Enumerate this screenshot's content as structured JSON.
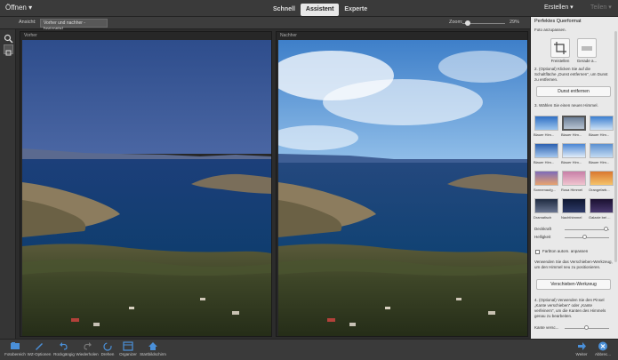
{
  "topbar": {
    "open_label": "Öffnen ▾",
    "tabs": [
      {
        "label": "Schnell"
      },
      {
        "label": "Assistent"
      },
      {
        "label": "Experte"
      }
    ],
    "create_label": "Erstellen ▾",
    "share_label": "Teilen ▾"
  },
  "viewbar": {
    "view_label": "Ansicht:",
    "view_value": "Vorher und nachher - horizontal",
    "zoom_label": "Zoom:",
    "zoom_value": "29%",
    "zoom_level": 0.12
  },
  "canvas": {
    "before_label": "Vorher",
    "after_label": "Nachher"
  },
  "sidepanel": {
    "title": "Perfektes Querformat",
    "intro": "Foto anzupassen.",
    "tool_labels": [
      "Freistellen",
      "Gerade a..."
    ],
    "step2": "2. (Optional) Klicken Sie auf die Schaltfläche „Dunst entfernen“, um Dunst zu entfernen.",
    "dehaze_button": "Dunst entfernen",
    "step3": "3. Wählen Sie einen neuen Himmel.",
    "skies": [
      {
        "label": "Blauer Him..."
      },
      {
        "label": "Blauer Him..."
      },
      {
        "label": "Blauer Him..."
      },
      {
        "label": "Blauer Him..."
      },
      {
        "label": "Blauer Him..."
      },
      {
        "label": "Blauer Him..."
      },
      {
        "label": "Sonnenaufg..."
      },
      {
        "label": "Rosa Himmel"
      },
      {
        "label": "Orangefarb..."
      },
      {
        "label": "Dramatisch"
      },
      {
        "label": "Nachthimmel"
      },
      {
        "label": "Galaxie bei ..."
      }
    ],
    "opacity_label": "Deckkraft",
    "opacity_value": 0.95,
    "brightness_label": "Helligkeit",
    "brightness_value": 0.45,
    "auto_color_label": "Farbton autom. anpassen",
    "move_tool_text": "Verwenden Sie das Verschieben-Werkzeug, um den Himmel neu zu positionieren.",
    "move_tool_button": "Verschieben-Werkzeug",
    "step4": "4. (Optional) Verwenden Sie den Pinsel „Kante verschieben“ oder „Kante verfeinern“, um die Kanten des Himmels genau zu bearbeiten.",
    "edge_label": "Kante versc...",
    "edge_value": 0.5
  },
  "bottombar": {
    "items": [
      {
        "label": "Fotobereich",
        "icon": "photo-bin-icon"
      },
      {
        "label": "WZ-Optionen",
        "icon": "tool-options-icon"
      },
      {
        "label": "Rückgängig",
        "icon": "undo-icon"
      },
      {
        "label": "Wiederholen",
        "icon": "redo-icon"
      },
      {
        "label": "Drehen",
        "icon": "rotate-icon"
      },
      {
        "label": "Organizer",
        "icon": "organizer-icon"
      },
      {
        "label": "Startbildschirm",
        "icon": "home-screen-icon"
      }
    ],
    "next_label": "Weiter",
    "cancel_label": "Abbrec..."
  }
}
